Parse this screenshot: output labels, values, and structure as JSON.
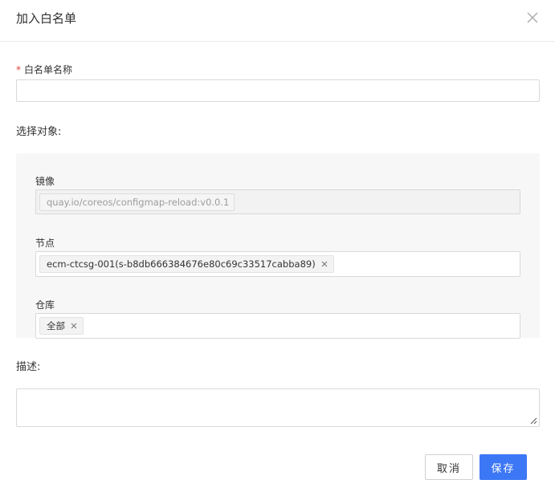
{
  "dialog": {
    "title": "加入白名单",
    "close_icon": "close-icon"
  },
  "form": {
    "name": {
      "required_mark": "*",
      "label": "白名单名称",
      "value": "",
      "placeholder": ""
    },
    "select_objects": {
      "label": "选择对象:",
      "image": {
        "label": "镜像",
        "disabled": true,
        "tags": [
          "quay.io/coreos/configmap-reload:v0.0.1"
        ]
      },
      "node": {
        "label": "节点",
        "tags": [
          "ecm-ctcsg-001(s-b8db666384676e80c69c33517cabba89)"
        ]
      },
      "repository": {
        "label": "仓库",
        "tags": [
          "全部"
        ]
      }
    },
    "description": {
      "label": "描述:",
      "value": ""
    }
  },
  "footer": {
    "cancel_label": "取消",
    "save_label": "保存"
  },
  "colors": {
    "primary": "#3c77f5",
    "required": "#e0433b",
    "panel_bg": "#f7f7f7",
    "border": "#d9d9d9"
  }
}
